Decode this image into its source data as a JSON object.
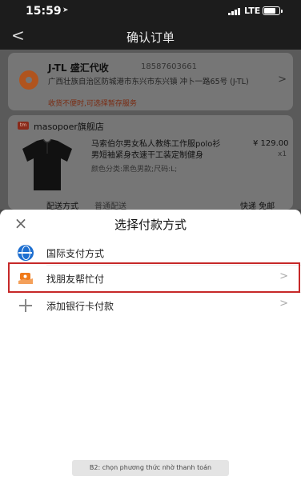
{
  "status_bar": {
    "time": "15:59",
    "network": "LTE"
  },
  "nav": {
    "title": "确认订单",
    "back_glyph": "<"
  },
  "address": {
    "name": "J-TL 盛汇代收",
    "phone": "18587603661",
    "line": "广西壮族自治区防城港市东兴市东兴镇 冲卜一路65号 (J-TL)",
    "note": "收货不便时,可选择暂存服务"
  },
  "shop": {
    "name": "masopoer旗舰店",
    "product_title": "马索伯尔男女私人教练工作服polo衫男短袖紧身衣速干工装定制健身",
    "spec": "颜色分类:黑色男款;尺码:L;",
    "price": "¥ 129.00",
    "qty": "x1",
    "shipping_label": "配送方式",
    "shipping_value": "普通配送",
    "shipping_right": "快递 免邮"
  },
  "sheet": {
    "title": "选择付款方式",
    "options": [
      {
        "label": "国际支付方式",
        "icon": "globe-icon"
      },
      {
        "label": "找朋友帮忙付",
        "icon": "friend-pay-icon"
      },
      {
        "label": "添加银行卡付款",
        "icon": "plus-icon"
      }
    ]
  },
  "caption": "B2: chọn phương thức nhờ thanh toán",
  "colors": {
    "highlight": "#c62828",
    "globe": "#1e6fd0",
    "friend_pay": "#f07a1a"
  }
}
